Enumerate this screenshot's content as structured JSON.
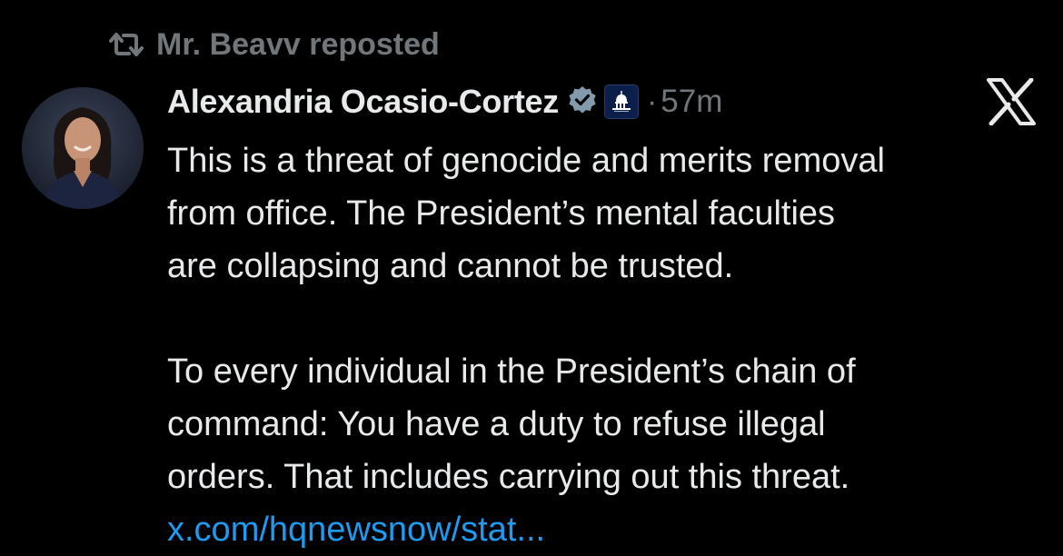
{
  "repost": {
    "icon": "repost-icon",
    "text": "Mr. Beavv reposted"
  },
  "author": {
    "name": "Alexandria Ocasio-Cortez",
    "verified_icon": "verified-badge-icon",
    "affiliation_icon": "capitol-building-icon",
    "timestamp": "57m",
    "separator": "·"
  },
  "tweet": {
    "paragraph1": [
      "This is a threat of genocide and merits removal",
      "from office. The President’s mental faculties",
      "are collapsing and cannot be trusted."
    ],
    "paragraph2": [
      "To every individual in the President’s chain of",
      "command: You have a duty to refuse illegal",
      "orders. That includes carrying out this threat."
    ],
    "link": "x.com/hqnewsnow/stat..."
  },
  "platform_logo": "x-logo-icon",
  "colors": {
    "background": "#000000",
    "text": "#e7e9ea",
    "muted": "#71767b",
    "link": "#1d9bf0"
  }
}
